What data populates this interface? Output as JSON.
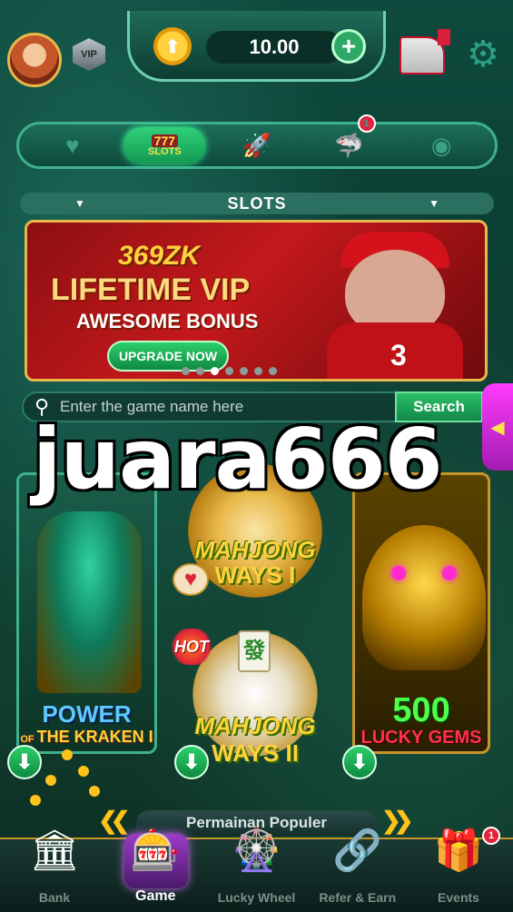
{
  "header": {
    "balance": "10.00",
    "vip_label": "VIP",
    "add_label": "+"
  },
  "categories": {
    "items": [
      {
        "name": "favorites",
        "icon": "heart-icon"
      },
      {
        "name": "slots",
        "icon": "slots-icon",
        "label_number": "777",
        "label_text": "SLOTS",
        "active": true
      },
      {
        "name": "crash",
        "icon": "rocket-icon"
      },
      {
        "name": "fishing",
        "icon": "shark-icon",
        "badge": "1"
      },
      {
        "name": "table",
        "icon": "table-game-icon"
      }
    ],
    "section_title": "SLOTS"
  },
  "banner": {
    "brand": "369ZK",
    "headline": "LIFETIME VIP",
    "subheadline": "AWESOME BONUS",
    "cta": "UPGRADE NOW",
    "player_number": "3",
    "slides": 7,
    "active_slide": 2
  },
  "search": {
    "placeholder": "Enter the game name here",
    "button": "Search"
  },
  "watermark": "juara666",
  "games": [
    {
      "id": "kraken",
      "title_top": "POWER",
      "title_of": "OF",
      "title_bottom": "THE KRAKEN I"
    },
    {
      "id": "mahjong1",
      "title": "MAHJONG",
      "subtitle": "WAYS I"
    },
    {
      "id": "mahjong2",
      "title": "MAHJONG",
      "subtitle": "WAYS II",
      "tile": "發",
      "hot_label": "HOT"
    },
    {
      "id": "lucky-gems",
      "title": "500",
      "subtitle": "LUCKY GEMS"
    }
  ],
  "popular": {
    "title": "Permainan Populer"
  },
  "bottom_nav": {
    "items": [
      {
        "label": "Bank",
        "icon": "bank-icon"
      },
      {
        "label": "Game",
        "icon": "slot-machine-icon",
        "active": true
      },
      {
        "label": "Lucky Wheel",
        "icon": "wheel-icon"
      },
      {
        "label": "Refer & Earn",
        "icon": "share-icon"
      },
      {
        "label": "Events",
        "icon": "gift-icon",
        "badge": "1"
      }
    ]
  },
  "colors": {
    "accent": "#2fa866",
    "gold": "#ffc21a",
    "badge": "#e0243a",
    "bg": "#0c3b2e"
  }
}
